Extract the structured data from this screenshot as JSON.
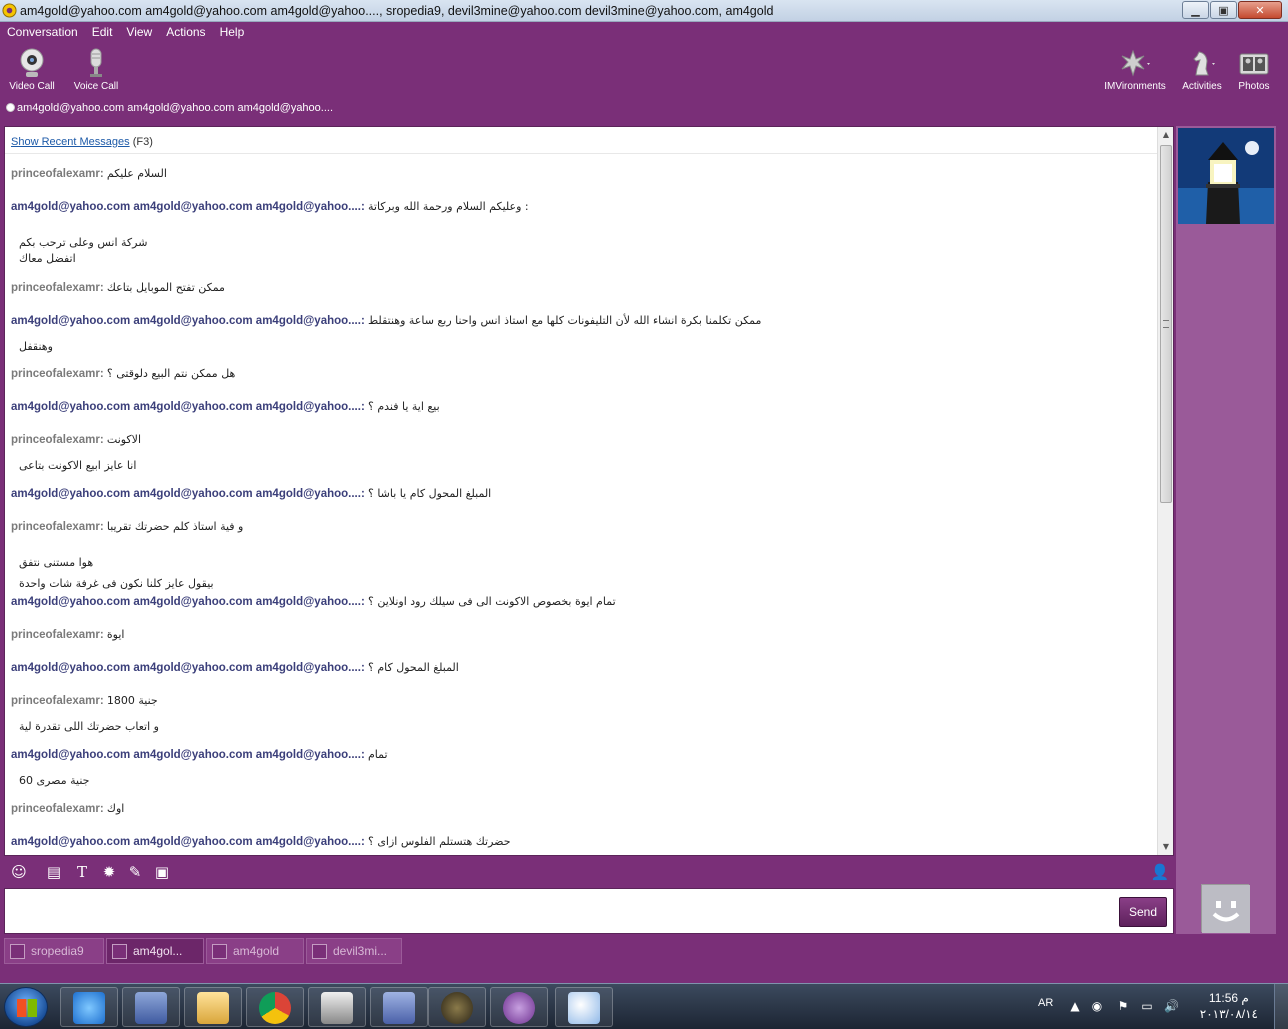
{
  "window": {
    "title": "am4gold@yahoo.com am4gold@yahoo.com am4gold@yahoo...., sropedia9, devil3mine@yahoo.com devil3mine@yahoo.com, am4gold",
    "minimize": "▁",
    "maximize": "▣",
    "close": "✕"
  },
  "menu": [
    "Conversation",
    "Edit",
    "View",
    "Actions",
    "Help"
  ],
  "toolbar": {
    "video_call": "Video Call",
    "voice_call": "Voice Call",
    "imvironments": "IMVironments",
    "activities": "Activities",
    "photos": "Photos"
  },
  "recipient": "am4gold@yahoo.com am4gold@yahoo.com am4gold@yahoo....",
  "conversation": {
    "show_recent": "Show Recent Messages",
    "shortcut": "(F3)",
    "messages": [
      {
        "sender": "princeofalexamr:",
        "text": "السلام عليكم",
        "who": "prince"
      },
      {
        "sender": "am4gold@yahoo.com am4gold@yahoo.com am4gold@yahoo....:",
        "text": "وعليكم السلام ورحمة الله وبركاتة :",
        "who": "am",
        "cont": [
          "شركة انس وعلى ترحب بكم",
          "اتفضل معاك"
        ]
      },
      {
        "sender": "princeofalexamr:",
        "text": "ممكن تفتح الموبايل بتاعك",
        "who": "prince"
      },
      {
        "sender": "am4gold@yahoo.com am4gold@yahoo.com am4gold@yahoo....:",
        "text": "ممكن تكلمنا بكرة انشاء الله لأن التليفونات كلها مع استاذ انس واحنا ربع ساعة وهنتقلط",
        "who": "am",
        "cont": [
          "وهنقفل"
        ]
      },
      {
        "sender": "princeofalexamr:",
        "text": "هل ممكن نتم البيع دلوقتى ؟",
        "who": "prince"
      },
      {
        "sender": "am4gold@yahoo.com am4gold@yahoo.com am4gold@yahoo....:",
        "text": "بيع اية يا فندم ؟",
        "who": "am"
      },
      {
        "sender": "princeofalexamr:",
        "text": "الاكونت",
        "who": "prince",
        "cont": [
          "انا عايز ابيع الاكونت بتاعى"
        ]
      },
      {
        "sender": "am4gold@yahoo.com am4gold@yahoo.com am4gold@yahoo....:",
        "text": "المبلغ المحول كام يا باشا ؟",
        "who": "am"
      },
      {
        "sender": "princeofalexamr:",
        "text": "و فية استاذ كلم حضرتك تقريبا",
        "who": "prince",
        "cont": [
          "هوا مستنى نتفق",
          "بيقول عايز كلنا نكون فى غرفة شات واحدة"
        ]
      },
      {
        "sender": "am4gold@yahoo.com am4gold@yahoo.com am4gold@yahoo....:",
        "text": "تمام ايوة بخصوص الاكونت الى فى سيلك رود اونلاين ؟",
        "who": "am"
      },
      {
        "sender": "princeofalexamr:",
        "text": "ايوة",
        "who": "prince"
      },
      {
        "sender": "am4gold@yahoo.com am4gold@yahoo.com am4gold@yahoo....:",
        "text": "المبلغ المحول كام ؟",
        "who": "am"
      },
      {
        "sender": "princeofalexamr:",
        "text": "1800 جنية",
        "who": "prince",
        "cont": [
          "و اتعاب حضرتك اللى تقدرة لية"
        ]
      },
      {
        "sender": "am4gold@yahoo.com am4gold@yahoo.com am4gold@yahoo....:",
        "text": "تمام",
        "who": "am",
        "cont": [
          "60 جنية مصرى"
        ]
      },
      {
        "sender": "princeofalexamr:",
        "text": "اوك",
        "who": "prince"
      },
      {
        "sender": "am4gold@yahoo.com am4gold@yahoo.com am4gold@yahoo....:",
        "text": "حضرتك هتستلم الفلوس ازاى ؟",
        "who": "am"
      }
    ]
  },
  "input": {
    "send": "Send",
    "value": ""
  },
  "tabs": [
    {
      "label": "sropedia9",
      "active": false
    },
    {
      "label": "am4gol...",
      "active": true
    },
    {
      "label": "am4gold",
      "active": false
    },
    {
      "label": "devil3mi...",
      "active": false
    }
  ],
  "taskbar": {
    "language": "AR",
    "time": "11:56 م",
    "date": "٢٠١٣/٠٨/١٤",
    "apps": [
      "internet-explorer",
      "network-config",
      "file-explorer",
      "chrome",
      "video-editor",
      "network-tool",
      "game-client",
      "yahoo-messenger",
      "paint"
    ]
  },
  "colors": {
    "accent": "#7a2f78",
    "sender_prince": "#7a7a7a",
    "sender_am": "#3b3f7a"
  }
}
